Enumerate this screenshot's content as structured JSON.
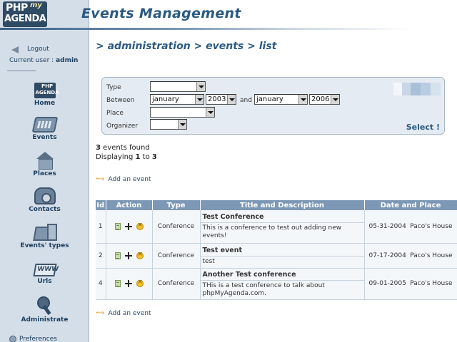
{
  "logo": {
    "php": "PHP",
    "my": "my",
    "agenda": "AGENDA"
  },
  "header": {
    "title": "Events Management"
  },
  "sidebar": {
    "logout": "Logout",
    "current_user_label": "Current user :",
    "current_user": "admin",
    "items": [
      {
        "label": "Home",
        "icon": "home-icon"
      },
      {
        "label": "Events",
        "icon": "calendar-icon"
      },
      {
        "label": "Places",
        "icon": "house-icon"
      },
      {
        "label": "Contacts",
        "icon": "phone-icon"
      },
      {
        "label": "Events' types",
        "icon": "event-types-icon"
      },
      {
        "label": "Urls",
        "icon": "www-icon"
      },
      {
        "label": "Administrate",
        "icon": "key-icon"
      }
    ],
    "preferences": "Preferences"
  },
  "breadcrumb": "> administration > events > list",
  "filter": {
    "type_label": "Type",
    "type_value": "",
    "between_label": "Between",
    "from_month": "january",
    "from_year": "2003",
    "and_label": "and",
    "to_month": "january",
    "to_year": "2006",
    "place_label": "Place",
    "place_value": "",
    "organizer_label": "Organizer",
    "organizer_value": "",
    "select_label": "Select !"
  },
  "summary": {
    "count": "3",
    "found_text": "events found",
    "displaying_text": "Displaying",
    "from": "1",
    "to_text": "to",
    "to": "3"
  },
  "add_event_label": "Add an event",
  "table": {
    "headers": [
      "Id",
      "Action",
      "Type",
      "Title and Description",
      "Date and Place"
    ],
    "rows": [
      {
        "id": "1",
        "type": "Conference",
        "title": "Test Conference",
        "description": "This is a conference to test out adding new events!",
        "date": "05-31-2004",
        "place": "Paco's House"
      },
      {
        "id": "2",
        "type": "Conference",
        "title": "Test event",
        "description": "test",
        "date": "07-17-2004",
        "place": "Paco's House"
      },
      {
        "id": "4",
        "type": "Conference",
        "title": "Another Test conference",
        "description": "THis is a test conference to talk about phpMyAgenda.com.",
        "date": "09-01-2005",
        "place": "Paco's House"
      }
    ]
  }
}
